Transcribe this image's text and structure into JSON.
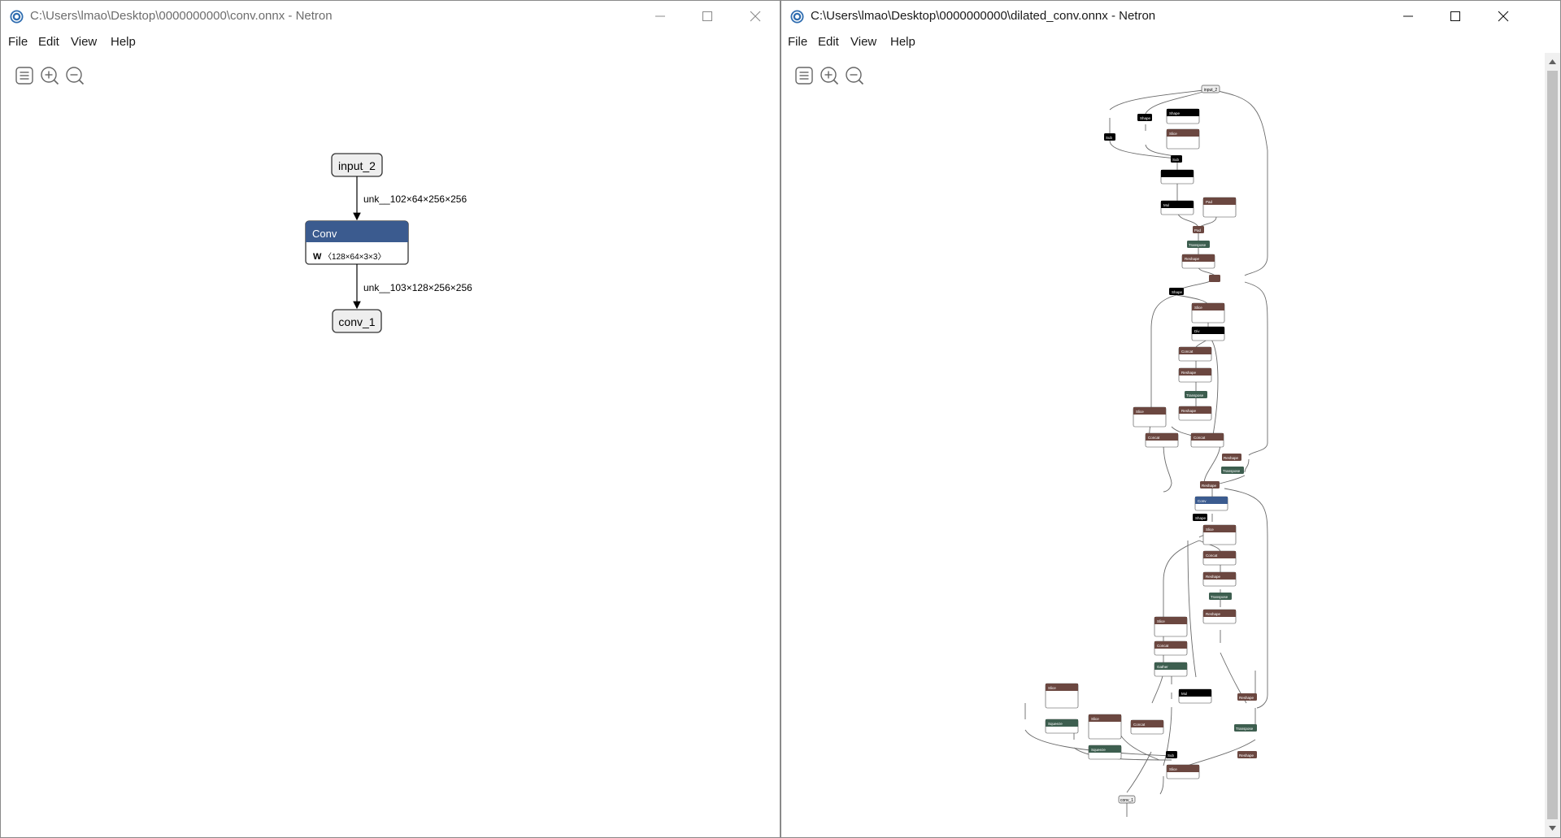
{
  "left_window": {
    "title": "C:\\Users\\lmao\\Desktop\\0000000000\\conv.onnx - Netron",
    "menu": [
      "File",
      "Edit",
      "View",
      "Help"
    ],
    "toolbar_icons": [
      "sidebar-icon",
      "zoom-in-icon",
      "zoom-out-icon"
    ],
    "graph": {
      "input_node": "input_2",
      "edge_in_label": "unk__102×64×256×256",
      "conv_node": {
        "op": "Conv",
        "attr_name": "W",
        "attr_value": "〈128×64×3×3〉"
      },
      "edge_out_label": "unk__103×128×256×256",
      "output_node": "conv_1"
    }
  },
  "right_window": {
    "title": "C:\\Users\\lmao\\Desktop\\0000000000\\dilated_conv.onnx - Netron",
    "menu": [
      "File",
      "Edit",
      "View",
      "Help"
    ],
    "toolbar_icons": [
      "sidebar-icon",
      "zoom-in-icon",
      "zoom-out-icon"
    ],
    "graph_nodes": {
      "input": "input_2",
      "shape1": "Shape",
      "shape2": "Shape",
      "slice1": "Slice",
      "sub1": "Sub",
      "sub2": "Sub",
      "mul1": "Mul",
      "pad1": "Pad",
      "pad2": "Pad",
      "transpose1": "Transpose",
      "reshape1": "Reshape",
      "shape3": "Shape",
      "slice2": "Slice",
      "div1": "Div",
      "concat1": "Concat",
      "reshape2": "Reshape",
      "transpose2": "Transpose",
      "reshape3": "Reshape",
      "slice3": "Slice",
      "concat2": "Concat",
      "concat3": "Concat",
      "reshape4": "Reshape",
      "transpose3": "Transpose",
      "reshape5": "Reshape",
      "conv": "Conv",
      "shape4": "Shape",
      "slice4": "Slice",
      "concat4": "Concat",
      "reshape6": "Reshape",
      "transpose4": "Transpose",
      "reshape7": "Reshape",
      "slice5": "Slice",
      "concat5": "Concat",
      "gather1": "Gather",
      "mul2": "Mul",
      "slice6": "Slice",
      "squeeze1": "Squeeze",
      "slice7": "Slice",
      "squeeze2": "Squeeze",
      "concat6": "Concat",
      "reshape8": "Reshape",
      "transpose5": "Transpose",
      "sub3": "Sub",
      "reshape9": "Reshape",
      "slice8": "Slice",
      "output": "conv_1"
    }
  },
  "colors": {
    "conv_blue": "#3b5b8f",
    "layer_brown": "#6b4740",
    "shape_black": "#000000",
    "transpose_green": "#3d5e4f",
    "node_border": "#444444",
    "io_fill": "#eeeeee"
  }
}
